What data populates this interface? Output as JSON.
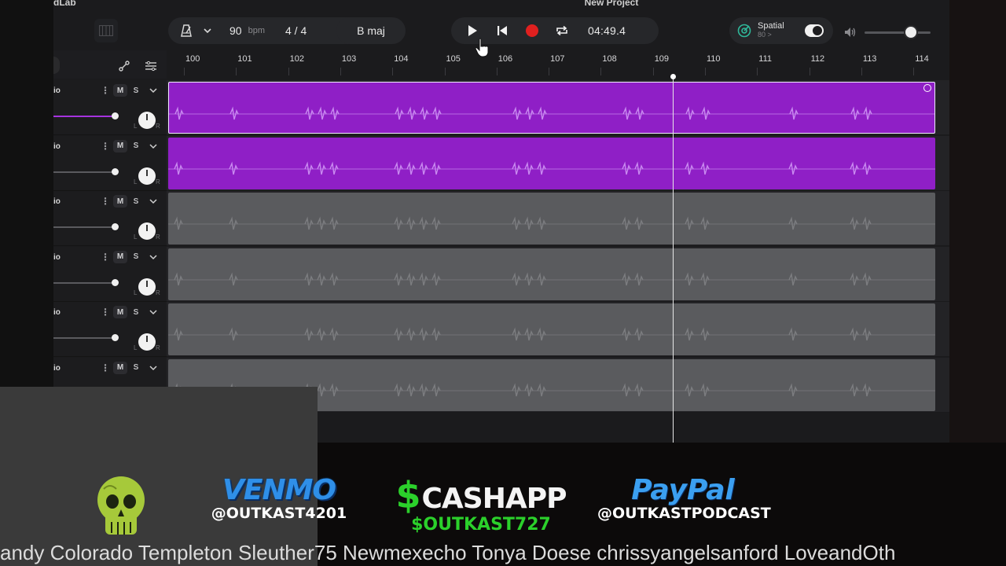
{
  "app": {
    "name": "dLab",
    "project_title": "New Project"
  },
  "toolbar": {
    "tempo_value": "90",
    "tempo_unit": "bpm",
    "time_signature": "4 / 4",
    "key": "B maj",
    "time_display": "04:49.4",
    "spatial_label": "Spatial",
    "spatial_sub": "80 >",
    "spatial_enabled": true,
    "volume_level": 0.75
  },
  "ruler": {
    "bars": [
      "100",
      "101",
      "102",
      "103",
      "104",
      "105",
      "106",
      "107",
      "108",
      "109",
      "110",
      "111",
      "112",
      "113",
      "114"
    ]
  },
  "tracks": [
    {
      "name": "io",
      "mute_label": "M",
      "solo_label": "S",
      "clip_color": "purple",
      "selected": true,
      "active_fader": true,
      "pan_l": "L",
      "pan_r": "R"
    },
    {
      "name": "io",
      "mute_label": "M",
      "solo_label": "S",
      "clip_color": "purple",
      "selected": false,
      "active_fader": false,
      "pan_l": "L",
      "pan_r": "R"
    },
    {
      "name": "io",
      "mute_label": "M",
      "solo_label": "S",
      "clip_color": "gray",
      "selected": false,
      "active_fader": false,
      "pan_l": "L",
      "pan_r": "R"
    },
    {
      "name": "io",
      "mute_label": "M",
      "solo_label": "S",
      "clip_color": "gray",
      "selected": false,
      "active_fader": false,
      "pan_l": "L",
      "pan_r": "R"
    },
    {
      "name": "io",
      "mute_label": "M",
      "solo_label": "S",
      "clip_color": "gray",
      "selected": false,
      "active_fader": false,
      "pan_l": "L",
      "pan_r": "R"
    },
    {
      "name": "io",
      "mute_label": "M",
      "solo_label": "S",
      "clip_color": "gray",
      "selected": false,
      "active_fader": false,
      "pan_l": "L",
      "pan_r": "R"
    }
  ],
  "overlay": {
    "venmo_brand": "VENMO",
    "venmo_handle": "@OUTKAST4201",
    "cashapp_symbol": "$",
    "cashapp_brand": "CASHAPP",
    "cashapp_handle": "$OUTKAST727",
    "paypal_brand": "PayPal",
    "paypal_handle": "@OUTKASTPODCAST",
    "ticker": "andy Colorado  Templeton Sleuther75  Newmexecho Tonya Doese chrissyangelsanford LoveandOth"
  },
  "colors": {
    "clip_purple": "#8f1fc6",
    "clip_gray": "#5a5b5e",
    "record_red": "#e0201f",
    "venmo_blue": "#2f8fe8",
    "cashapp_green": "#2bd02b",
    "paypal_blue": "#3b9ff0",
    "skull_green": "#a6c93a"
  }
}
